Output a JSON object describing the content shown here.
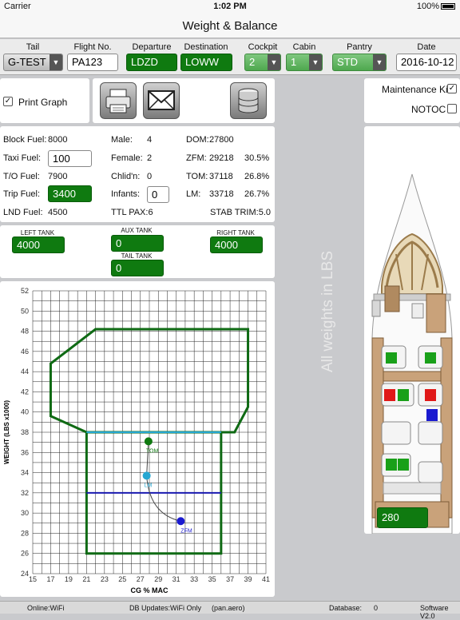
{
  "status": {
    "carrier": "Carrier",
    "time": "1:02 PM",
    "battery": "100%"
  },
  "nav": {
    "title": "Weight & Balance"
  },
  "header": {
    "tail_label": "Tail",
    "tail_value": "G-TEST",
    "flight_label": "Flight No.",
    "flight_value": "PA123",
    "departure_label": "Departure",
    "departure_value": "LDZD",
    "destination_label": "Destination",
    "destination_value": "LOWW",
    "cockpit_label": "Cockpit",
    "cockpit_value": "2",
    "cabin_label": "Cabin",
    "cabin_value": "1",
    "pantry_label": "Pantry",
    "pantry_value": "STD",
    "date_label": "Date",
    "date_value": "2016-10-12"
  },
  "options": {
    "print_graph": "Print Graph",
    "maintenance_kit": "Maintenance Kit",
    "notoc": "NOTOC"
  },
  "fuel": {
    "block_label": "Block Fuel:",
    "block_value": "8000",
    "taxi_label": "Taxi Fuel:",
    "taxi_value": "100",
    "to_label": "T/O Fuel:",
    "to_value": "7900",
    "trip_label": "Trip Fuel:",
    "trip_value": "3400",
    "lnd_label": "LND Fuel:",
    "lnd_value": "4500"
  },
  "pax": {
    "male_label": "Male:",
    "male_value": "4",
    "female_label": "Female:",
    "female_value": "2",
    "child_label": "Chlid'n:",
    "child_value": "0",
    "infants_label": "Infants:",
    "infants_value": "0",
    "ttl": "TTL PAX:6"
  },
  "weights": {
    "dom_label": "DOM:",
    "dom_value": "27800",
    "zfm_label": "ZFM:",
    "zfm_value": "29218",
    "zfm_pct": "30.5%",
    "tom_label": "TOM:",
    "tom_value": "37118",
    "tom_pct": "26.8%",
    "lm_label": "LM:",
    "lm_value": "33718",
    "lm_pct": "26.7%",
    "stab": "STAB TRIM:5.0"
  },
  "tanks": {
    "left_label": "LEFT TANK",
    "left_value": "4000",
    "aux_label": "AUX TANK",
    "aux_value": "0",
    "tail_label": "TAIL TANK",
    "tail_value": "0",
    "right_label": "RIGHT TANK",
    "right_value": "4000"
  },
  "side_note": "All weights in LBS",
  "cabin_value": "280",
  "colors": {
    "green": "#0f7a10",
    "seat_red": "#e01818",
    "seat_blue": "#1a1ad0",
    "envelope": "#0f6a14",
    "tom_line": "#26a7d2",
    "lm_line": "#1a1ab0"
  },
  "chart_data": {
    "type": "scatter",
    "title": "",
    "xlabel": "CG % MAC",
    "ylabel": "WEIGHT (LBS x1000)",
    "xlim": [
      15,
      41
    ],
    "ylim": [
      24,
      52
    ],
    "xticks": [
      15,
      17,
      19,
      21,
      23,
      25,
      27,
      29,
      31,
      33,
      35,
      37,
      39,
      41
    ],
    "yticks": [
      24,
      26,
      28,
      30,
      32,
      34,
      36,
      38,
      40,
      42,
      44,
      46,
      48,
      50,
      52
    ],
    "grid": true,
    "envelope": {
      "upper": [
        [
          21,
          38
        ],
        [
          17,
          39.6
        ],
        [
          17,
          44.8
        ],
        [
          22,
          48.2
        ],
        [
          39,
          48.2
        ],
        [
          39,
          40.5
        ],
        [
          37.5,
          38
        ],
        [
          21,
          38
        ]
      ],
      "lower": [
        [
          21,
          38
        ],
        [
          21,
          26
        ],
        [
          36,
          26
        ],
        [
          36,
          38
        ]
      ]
    },
    "limit_lines": [
      {
        "name": "TOM limit",
        "y": 38,
        "x": [
          21,
          36
        ]
      },
      {
        "name": "LM limit",
        "y": 32,
        "x": [
          21,
          36
        ]
      }
    ],
    "points": [
      {
        "label": "TOM",
        "x": 27.9,
        "y": 37.1
      },
      {
        "label": "LM",
        "x": 27.7,
        "y": 33.7
      },
      {
        "label": "ZFM",
        "x": 31.5,
        "y": 29.2
      }
    ]
  },
  "footer": {
    "online": "Online:WiFi",
    "db": "DB Updates:WiFi Only",
    "domain": "(pan.aero)",
    "database": "Database:",
    "database_value": "0",
    "software": "Software V2.0"
  }
}
